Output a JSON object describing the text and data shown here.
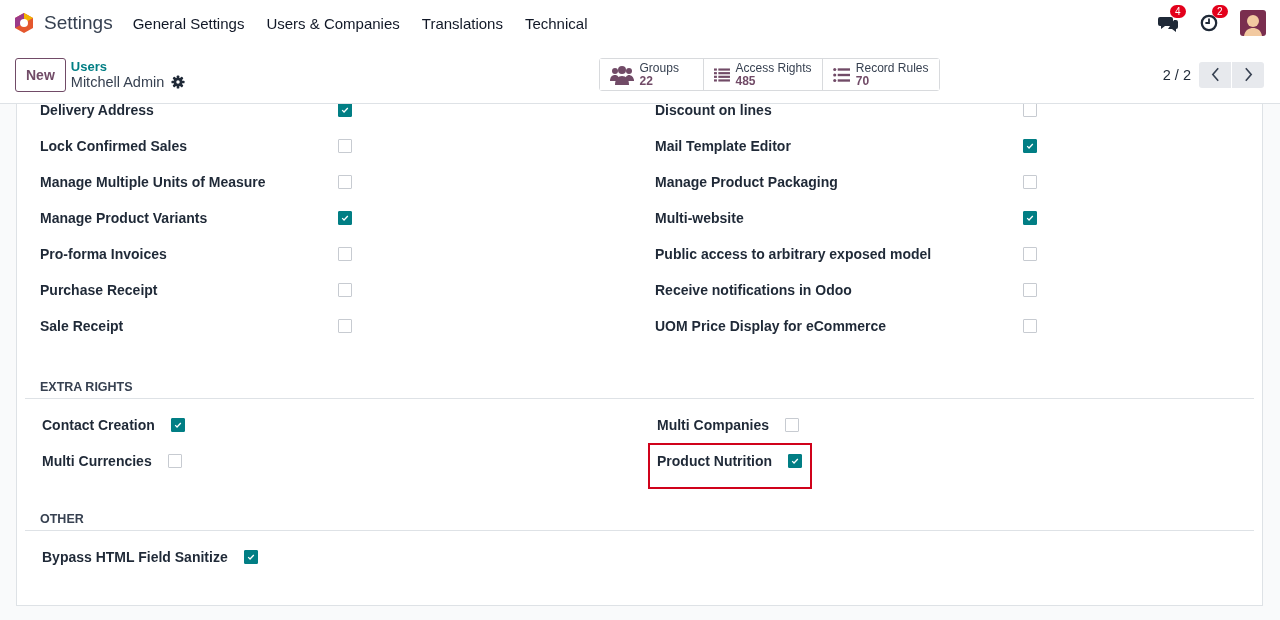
{
  "navbar": {
    "app": "Settings",
    "menu": [
      "General Settings",
      "Users & Companies",
      "Translations",
      "Technical"
    ],
    "chat_count": "4",
    "activity_count": "2"
  },
  "control_panel": {
    "new_button": "New",
    "breadcrumb": "Users",
    "record": "Mitchell Admin",
    "pager": "2 / 2",
    "smart_buttons": [
      {
        "kind": "groups",
        "label": "Groups",
        "count": "22"
      },
      {
        "kind": "list",
        "label": "Access Rights",
        "count": "485"
      },
      {
        "kind": "bullets",
        "label": "Record Rules",
        "count": "70"
      }
    ]
  },
  "rights": {
    "left": [
      {
        "label": "Delivery Address",
        "checked": true
      },
      {
        "label": "Lock Confirmed Sales",
        "checked": false
      },
      {
        "label": "Manage Multiple Units of Measure",
        "checked": false
      },
      {
        "label": "Manage Product Variants",
        "checked": true
      },
      {
        "label": "Pro-forma Invoices",
        "checked": false
      },
      {
        "label": "Purchase Receipt",
        "checked": false
      },
      {
        "label": "Sale Receipt",
        "checked": false
      }
    ],
    "right": [
      {
        "label": "Discount on lines",
        "checked": false
      },
      {
        "label": "Mail Template Editor",
        "checked": true
      },
      {
        "label": "Manage Product Packaging",
        "checked": false
      },
      {
        "label": "Multi-website",
        "checked": true
      },
      {
        "label": "Public access to arbitrary exposed model",
        "checked": false
      },
      {
        "label": "Receive notifications in Odoo",
        "checked": false
      },
      {
        "label": "UOM Price Display for eCommerce",
        "checked": false
      }
    ]
  },
  "sections": [
    {
      "title": "EXTRA RIGHTS",
      "left": [
        {
          "label": "Contact Creation",
          "checked": true,
          "highlighted": false
        },
        {
          "label": "Multi Currencies",
          "checked": false,
          "highlighted": false
        }
      ],
      "right": [
        {
          "label": "Multi Companies",
          "checked": false,
          "highlighted": false
        },
        {
          "label": "Product Nutrition",
          "checked": true,
          "highlighted": true
        }
      ]
    },
    {
      "title": "OTHER",
      "left": [
        {
          "label": "Bypass HTML Field Sanitize",
          "checked": true,
          "highlighted": false
        }
      ]
    }
  ]
}
